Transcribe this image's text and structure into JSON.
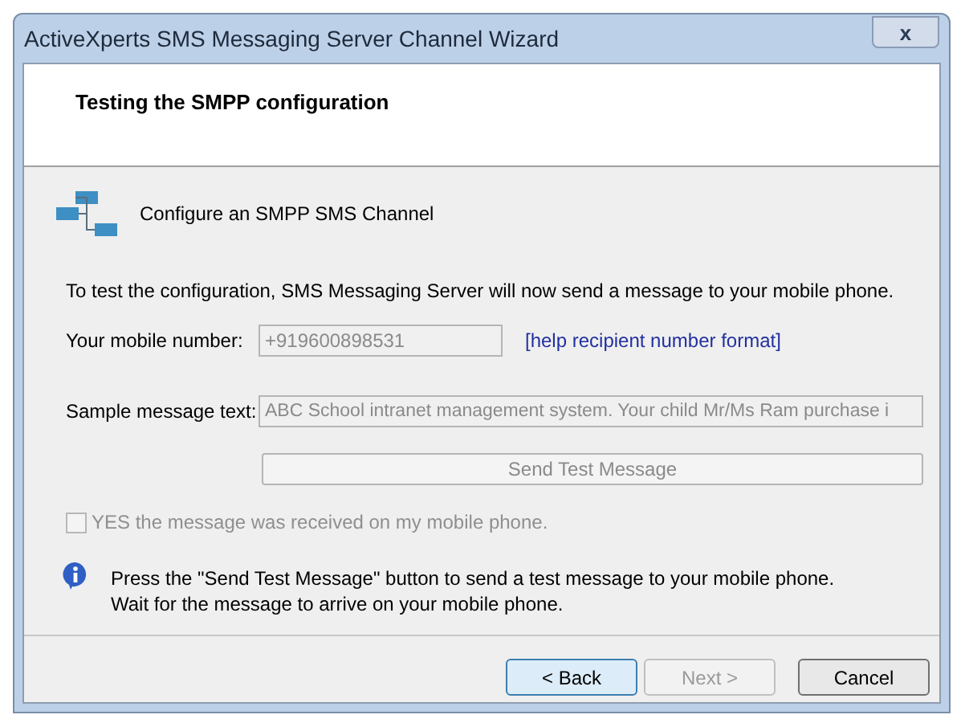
{
  "window": {
    "title": "ActiveXperts SMS Messaging Server Channel Wizard",
    "close": "x"
  },
  "header": {
    "title": "Testing the SMPP configuration"
  },
  "channel": {
    "label": "Configure an SMPP SMS Channel"
  },
  "intro": "To test the configuration, SMS Messaging Server will now send a message to your mobile phone.",
  "mobile": {
    "label": "Your mobile number:",
    "value": "+919600898531",
    "disabled": true,
    "help_link": "[help recipient number format]"
  },
  "sample": {
    "label": "Sample message text:",
    "value": "ABC School intranet management system. Your child Mr/Ms Ram purchase i",
    "disabled": true
  },
  "send_button": {
    "label": "Send Test Message",
    "disabled": true
  },
  "confirm": {
    "label": "YES the message was received on my mobile phone.",
    "checked": false,
    "disabled": true
  },
  "info": {
    "lines": [
      "Press the \"Send Test Message\" button to send a test message to your mobile phone.",
      "Wait for the message to arrive on your mobile phone."
    ]
  },
  "buttons": [
    {
      "label": "< Back",
      "disabled": false,
      "selected": true
    },
    {
      "label": "Next >",
      "disabled": true,
      "selected": false
    },
    {
      "label": "Cancel",
      "disabled": false,
      "selected": false
    }
  ]
}
